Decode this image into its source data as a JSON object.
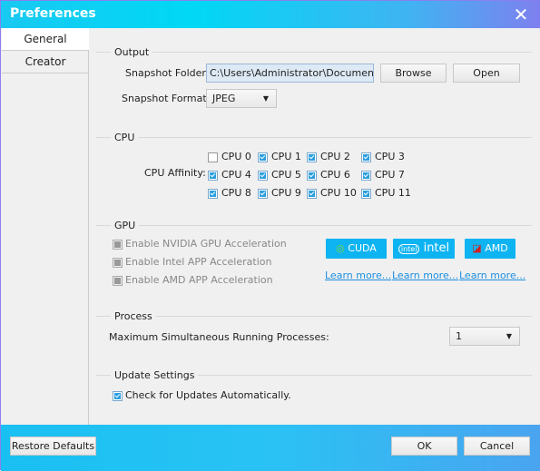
{
  "window": {
    "title": "Preferences",
    "accent": "#0eb4f2"
  },
  "sidebar": {
    "items": [
      {
        "label": "General",
        "selected": true
      },
      {
        "label": "Creator",
        "selected": false
      }
    ]
  },
  "output": {
    "section": "Output",
    "folder_label": "Snapshot Folder:",
    "folder_value": "C:\\Users\\Administrator\\Documents\\A",
    "browse": "Browse",
    "open": "Open",
    "format_label": "Snapshot Format:",
    "format_value": "JPEG"
  },
  "cpu": {
    "section": "CPU",
    "affinity_label": "CPU Affinity:",
    "cores": [
      {
        "label": "CPU 0",
        "checked": false
      },
      {
        "label": "CPU 1",
        "checked": true
      },
      {
        "label": "CPU 2",
        "checked": true
      },
      {
        "label": "CPU 3",
        "checked": true
      },
      {
        "label": "CPU 4",
        "checked": true
      },
      {
        "label": "CPU 5",
        "checked": true
      },
      {
        "label": "CPU 6",
        "checked": true
      },
      {
        "label": "CPU 7",
        "checked": true
      },
      {
        "label": "CPU 8",
        "checked": true
      },
      {
        "label": "CPU 9",
        "checked": true
      },
      {
        "label": "CPU 10",
        "checked": true
      },
      {
        "label": "CPU 11",
        "checked": true
      }
    ]
  },
  "gpu": {
    "section": "GPU",
    "options": [
      "Enable NVIDIA GPU Acceleration",
      "Enable Intel APP Acceleration",
      "Enable AMD APP Acceleration"
    ],
    "badges": [
      {
        "label": "CUDA",
        "icon": "nvidia-logo"
      },
      {
        "label": "intel",
        "icon": "intel-logo"
      },
      {
        "label": "AMD",
        "icon": "amd-logo"
      }
    ],
    "learn_more": "Learn more..."
  },
  "process": {
    "section": "Process",
    "label": "Maximum Simultaneous Running Processes:",
    "value": "1"
  },
  "update": {
    "section": "Update Settings",
    "check_label": "Check for Updates Automatically.",
    "checked": true
  },
  "footer": {
    "restore": "Restore Defaults",
    "ok": "OK",
    "cancel": "Cancel"
  }
}
